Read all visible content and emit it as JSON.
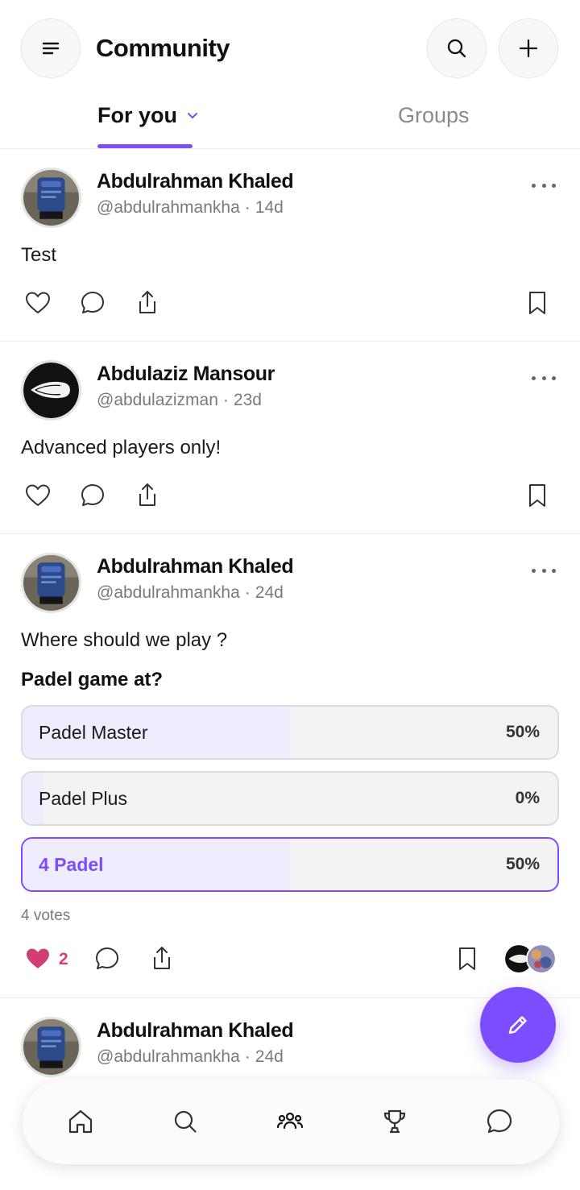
{
  "header": {
    "title": "Community",
    "menu_icon": "menu-icon",
    "search_icon": "search-icon",
    "add_icon": "plus-icon"
  },
  "tabs": [
    {
      "label": "For you",
      "active": true,
      "has_dropdown": true
    },
    {
      "label": "Groups",
      "active": false
    }
  ],
  "posts": [
    {
      "author": "Abdulrahman Khaled",
      "handle": "@abdulrahmankha",
      "separator": "·",
      "time": "14d",
      "text": "Test"
    },
    {
      "author": "Abdulaziz Mansour",
      "handle": "@abdulazizman",
      "separator": "·",
      "time": "23d",
      "text": "Advanced players only!"
    },
    {
      "author": "Abdulrahman Khaled",
      "handle": "@abdulrahmankha",
      "separator": "·",
      "time": "24d",
      "text": "Where should we play ?",
      "poll": {
        "question": "Padel game at?",
        "options": [
          {
            "label": "Padel Master",
            "percent_label": "50%",
            "fraction": 0.5,
            "selected": false
          },
          {
            "label": "Padel Plus",
            "percent_label": "0%",
            "fraction": 0.0,
            "selected": false
          },
          {
            "label": "4 Padel",
            "percent_label": "50%",
            "fraction": 0.5,
            "selected": true
          }
        ],
        "votes": "4 votes"
      },
      "likes": "2",
      "liked": true
    },
    {
      "author": "Abdulrahman Khaled",
      "handle": "@abdulrahmankha",
      "separator": "·",
      "time": "24d"
    }
  ],
  "colors": {
    "accent": "#7c4dff",
    "like": "#d23e73",
    "poll_fill": "#efedfd"
  },
  "bottom_nav": [
    {
      "icon": "home-icon",
      "active": false
    },
    {
      "icon": "search-icon",
      "active": false
    },
    {
      "icon": "community-icon",
      "active": true
    },
    {
      "icon": "trophy-icon",
      "active": false
    },
    {
      "icon": "chat-icon",
      "active": false
    }
  ],
  "fab_icon": "pencil-icon"
}
